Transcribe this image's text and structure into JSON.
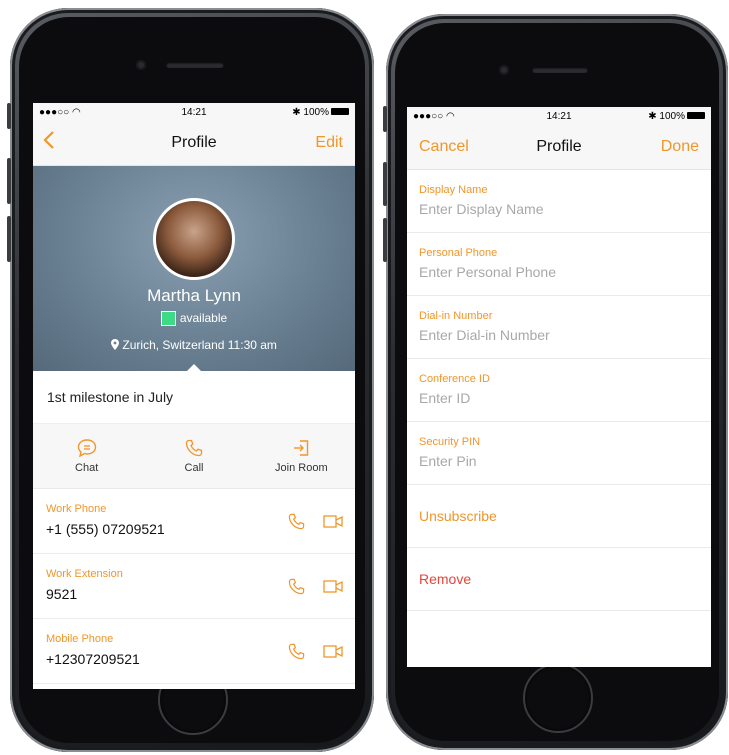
{
  "left_phone": {
    "status": {
      "carrier": "●●●○○",
      "time": "14:21",
      "battery": "100%"
    },
    "nav": {
      "back_label": "<",
      "title": "Profile",
      "edit_label": "Edit"
    },
    "profile": {
      "name": "Martha Lynn",
      "presence": "available",
      "location": "Zurich, Switzerland  11:30 am",
      "presence_color": "#3ddc84"
    },
    "status_message": "1st milestone in July",
    "actions": [
      {
        "label": "Chat",
        "icon": "chat-bubble-icon"
      },
      {
        "label": "Call",
        "icon": "phone-icon"
      },
      {
        "label": "Join Room",
        "icon": "join-room-icon"
      }
    ],
    "contacts": [
      {
        "label": "Work Phone",
        "value": "+1 (555) 07209521"
      },
      {
        "label": "Work Extension",
        "value": "9521"
      },
      {
        "label": "Mobile Phone",
        "value": "+12307209521"
      }
    ]
  },
  "right_phone": {
    "status": {
      "carrier": "●●●○○",
      "time": "14:21",
      "battery": "100%"
    },
    "nav": {
      "cancel_label": "Cancel",
      "title": "Profile",
      "done_label": "Done"
    },
    "fields": [
      {
        "label": "Display Name",
        "placeholder": "Enter Display Name"
      },
      {
        "label": "Personal Phone",
        "placeholder": "Enter Personal Phone"
      },
      {
        "label": "Dial-in Number",
        "placeholder": "Enter Dial-in Number"
      },
      {
        "label": "Conference ID",
        "placeholder": "Enter ID"
      },
      {
        "label": "Security PIN",
        "placeholder": "Enter Pin"
      }
    ],
    "unsubscribe_label": "Unsubscribe",
    "remove_label": "Remove"
  },
  "colors": {
    "accent": "#f0962a",
    "danger": "#e5443a",
    "hero": "#6a8193"
  }
}
